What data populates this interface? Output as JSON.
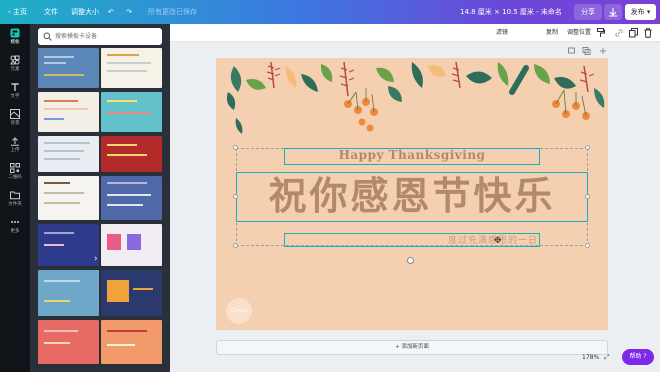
{
  "topbar": {
    "home": "主页",
    "file": "文件",
    "resize": "调整大小",
    "save_status": "所有更改已保存",
    "dimensions": "14.8 厘米 × 10.5 厘米 - 未命名",
    "share": "分享",
    "publish": "发布"
  },
  "rail": {
    "items": [
      {
        "label": "模板",
        "icon": "template-icon"
      },
      {
        "label": "元素",
        "icon": "elements-icon"
      },
      {
        "label": "文字",
        "icon": "text-icon"
      },
      {
        "label": "背景",
        "icon": "background-icon"
      },
      {
        "label": "上传",
        "icon": "upload-icon"
      },
      {
        "label": "二维码",
        "icon": "qrcode-icon"
      },
      {
        "label": "文件夹",
        "icon": "folder-icon"
      },
      {
        "label": "更多",
        "icon": "more-icon"
      }
    ]
  },
  "search": {
    "placeholder": "搜索模板卡设备"
  },
  "toolbar2": {
    "effects": "滤镜",
    "copy": "复制",
    "position": "调整位置"
  },
  "design": {
    "heading_en": "Happy Thanksgiving",
    "heading_cn": "祝你感恩节快乐",
    "subtitle": "度过充满感恩的一日",
    "logo": "Canva"
  },
  "canvas": {
    "add_page": "+ 添加新页面",
    "zoom": "178%",
    "help": "帮助 ?"
  },
  "colors": {
    "accent": "#7d2ae8",
    "page_bg": "#f4cfb0",
    "text_brown": "#b08a6a",
    "selection": "#1ab0c0"
  }
}
